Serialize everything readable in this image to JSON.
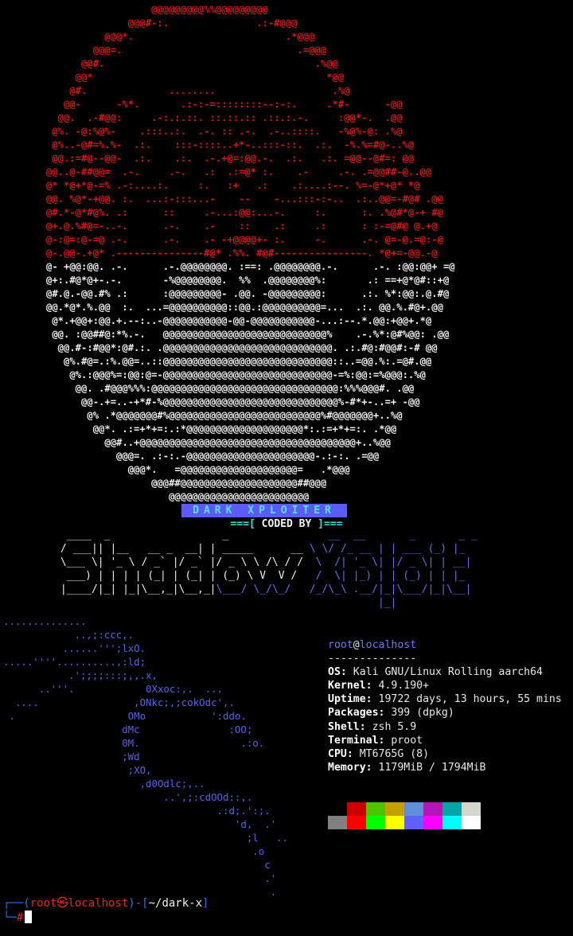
{
  "skull_lines": [
    {
      "c": "r",
      "t": "                  @@@@@@@@@%%@@@@@@@@@                  "
    },
    {
      "c": "r",
      "t": "              @@@#-:.               .:-#@@@              "
    },
    {
      "c": "r",
      "t": "          @@@*.                          .*@@@          "
    },
    {
      "c": "r",
      "t": "        @@@=.                              .=@@@        "
    },
    {
      "c": "r",
      "t": "      @@#.                                    .%@@      "
    },
    {
      "c": "r",
      "t": "     @@*                                        *@@     "
    },
    {
      "c": "r",
      "t": "    @#.              ........                    .%@    "
    },
    {
      "c": "r",
      "t": "   @@-      -%*.       .:-:-=::::::::--:-:.     .*#-      -@@   "
    },
    {
      "c": "r",
      "t": "  @@.  .-#@@:     .-:.:.::. ::.::.:: .::.:.-.     :@@*-.  .@@  "
    },
    {
      "c": "r",
      "t": " @%. -@:%@%-    .:::..:.  .-. :: .-.  .-..::::.   -%@%-@: .%@ "
    },
    {
      "c": "r",
      "t": " @%..-@#=%.%-  .:.    :::-::::..+*-..:::-::.  .:.  -%.%=#@-..%@"
    },
    {
      "c": "r",
      "t": " @@.:=#@--@@-  .:.    .:.  .-.+@=:@@.-.  .:.   .:. =@@--@#=: @@"
    },
    {
      "c": "r",
      "t": "@@..@-##@@=  .-.     .-.   .:  .:=@* :.    .-     .-. .=@@##-@..@@"
    },
    {
      "c": "r",
      "t": "@* *@+*@-=% .-:....:.     :.   :+   .:    .:....:--. %=-@*+@* *@"
    },
    {
      "c": "r",
      "t": "@@. %@*-+@@. :.  ...:-:::...-    --    -...:::-:-..  .:..@@=-#@# .@@"
    },
    {
      "c": "r",
      "t": "@#.*-@*#@%. .:      ::     .-...:@@:...-.     :.      :. .%@#*@-+ #@"
    },
    {
      "c": "r",
      "t": "@+.@.%#@=-..-.      .-.    .-    ::    .:     .:      : :-=@#@ @.+@"
    },
    {
      "c": "r",
      "t": "@-:@=:@-=@ .-.      .-.    .- -+@@@@+- :.     -.      .-. @=-@.=@:-@"
    },
    {
      "c": "r",
      "t": "@-.@@-.+@* .---------------#@* .%%. #@#----------------. *@+=-@@.-@"
    },
    {
      "c": "w",
      "t": "@- +@@:@@. .-.      .-.@@@@@@@@. :==: .@@@@@@@@.-.      .-. :@@:@@+ =@"
    },
    {
      "c": "w",
      "t": "@+:.#@*@+-.-.       -%@@@@@@@@.  %%  .@@@@@@@@%:       .: ==+@*@#::+@"
    },
    {
      "c": "w",
      "t": "@#.@.-@@.#% .:      :@@@@@@@@@- .@@. -@@@@@@@@@:      .:. %*:@@:.@.#@"
    },
    {
      "c": "w",
      "t": "@@.*@*.%.@@  :.  ...=@@@@@@@@@@::@@.:@@@@@@@@@@=...  .:. @@.%.#@+.@@"
    },
    {
      "c": "w",
      "t": " @*.+@@+:@@.+.--:..-@@@@@@@@@@@-@@-@@@@@@@@@@@-...:--.*.@@:+@@+.*@ "
    },
    {
      "c": "w",
      "t": " @@. :@@##@:*%.-.   @@@@@@@@@@@@@@@@@@@@@@@@@@@@%    .-.%*:@#%@@: .@@ "
    },
    {
      "c": "w",
      "t": "  @@.#-:#@@*:@#.:. .@@@@@@@@@@@@@@@@@@@@@@@@@@@@@. .:.#@:#@@#:-# @@  "
    },
    {
      "c": "w",
      "t": "   @%.#@=.:%.@@=..::@@@@@@@@@@@@@@@@@@@@@@@@@@@@@::..=@@.%:.=@#.@@   "
    },
    {
      "c": "w",
      "t": "    @%.:@@@%=:@@:@=-@@@@@@@@@@@@@@@@@@@@@@@@@@@@@-=%:@@:=%@@@:.%@    "
    },
    {
      "c": "w",
      "t": "     @@. .#@@@%%%:@@@@@@@@@@@@@@@@@@@@@@@@@@@@@@@@:%%%@@@#. .@@     "
    },
    {
      "c": "w",
      "t": "      @@-.+=..-+*#-%@@@@@@@@@@@@@@@@@@@@@@@@@@@@@@%-#*+-..=+ -@@      "
    },
    {
      "c": "w",
      "t": "       @% .*@@@@@@@#%@@@@@@@@@@@@@@@@@@@@@@@@@@%#@@@@@@@+..%@       "
    },
    {
      "c": "w",
      "t": "        @@*. .:=+*+=:.:*@@@@@@@@@@@@@@@@@@@@*:.:=+*+=:. .*@@        "
    },
    {
      "c": "w",
      "t": "          @@#..+@@@@@@@@@@@@@@@@@@@@@@@@@@@@@@@@@@@@@+..%@@          "
    },
    {
      "c": "w",
      "t": "            @@@=. .:-:.-@@@@@@@@@@@@@@@@@@@@@@-.:-:. .=@@            "
    },
    {
      "c": "w",
      "t": "              @@@*.   =@@@@@@@@@@@@@@@@@@@@=   .*@@@              "
    },
    {
      "c": "w",
      "t": "                  @@@##@@@@@@@@@@@@@@@@@@@@##@@@                  "
    },
    {
      "c": "w",
      "t": "                     @@@@@@@@@@@@@@@@@@@@@@@@                     "
    }
  ],
  "banner": {
    "text": "DARK XPLOITER"
  },
  "coded_by": {
    "left": "===[",
    "text": " CODED BY ",
    "right": "]==="
  },
  "shadow_lines": [
    {
      "a": "  ____  _                  _                ",
      "b": "__  __       _       _ _   "
    },
    {
      "a": " / ___|| |__   __ _  __| | _____      __ ",
      "b": "\\ \\/ /_ __ | | ___ (_) |_ "
    },
    {
      "a": " \\___ \\| '_ \\ / _` |/ _` |/ _ \\ \\ /\\ / / ",
      "b": " \\  /| '_ \\| |/ _ \\| | __|"
    },
    {
      "a": "  ___) | | | | (_| | (_| | (_) \\ V  V /  ",
      "b": " /  \\| |_) | | (_) | | |_ "
    },
    {
      "a": " |____/|_| |_|\\__,_|\\__,_|",
      "b": "\\___/ \\_/\\_/   /_/\\_\\ .__/|_|\\___/|_|\\__|"
    },
    {
      "a": "                                      ",
      "b": "              |_|                       "
    }
  ],
  "kali_logo": [
    "..............",
    "            ..,;:ccc,.",
    "          ......''';lxO.",
    ".....''''..........,:ld;",
    "           .';;;;:::;,,.x,",
    "      ..'''.            0Xxoc:,.  ...",
    "  ....                ,ONkc;,;cokOdc',.",
    " .                   OMo           ':ddo.",
    "                    dMc               :OO;",
    "                    0M.                 .:o.",
    "                    ;Wd",
    "                     ;XO,",
    "                       ,d0Odlc;,..",
    "                           ..',;:cdOOd::,.",
    "                                    .:d;.':;.",
    "                                       'd,  .'",
    "                                         ;l   ..",
    "                                          .o",
    "                                            c",
    "                                            .'",
    "                                             ."
  ],
  "sysinfo": {
    "user": "root",
    "at": "@",
    "host": "localhost",
    "separator": "--------------",
    "rows": [
      {
        "label": "OS:",
        "value": " Kali GNU/Linux Rolling aarch64"
      },
      {
        "label": "Kernel:",
        "value": " 4.9.190+"
      },
      {
        "label": "Uptime:",
        "value": " 19722 days, 13 hours, 55 mins"
      },
      {
        "label": "Packages:",
        "value": " 399 (dpkg)"
      },
      {
        "label": "Shell:",
        "value": " zsh 5.9"
      },
      {
        "label": "Terminal:",
        "value": " proot"
      },
      {
        "label": "CPU:",
        "value": " MT6765G (8)"
      },
      {
        "label": "Memory:",
        "value": " 1179MiB / 1794MiB"
      }
    ]
  },
  "palette": {
    "row1": [
      "#000000",
      "#cc0000",
      "#4ec500",
      "#c4a000",
      "#5f8fd8",
      "#b614b6",
      "#06a6a8",
      "#d3d7cf"
    ],
    "row2": [
      "#808080",
      "#ff0000",
      "#00ff00",
      "#ffff00",
      "#6060ff",
      "#ff00ff",
      "#00ffff",
      "#ffffff"
    ]
  },
  "prompt": {
    "corner_top": "┌──(",
    "user": "root",
    "skull": "㉿",
    "host": "localhost",
    "mid": ")-[",
    "path": "~/dark-x",
    "close": "]",
    "corner_bottom": "└─",
    "symbol": "#"
  }
}
